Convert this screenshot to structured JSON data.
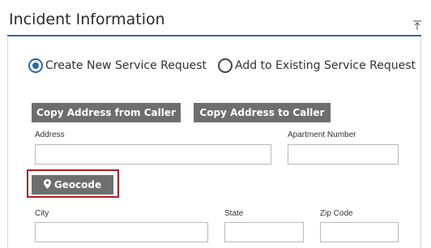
{
  "header": {
    "title": "Incident Information",
    "collapse_icon": "collapse-up-icon"
  },
  "request_type": {
    "options": [
      {
        "label": "Create New Service Request",
        "checked": true
      },
      {
        "label": "Add to Existing Service Request",
        "checked": false
      }
    ]
  },
  "buttons": {
    "copy_from_caller": "Copy Address from Caller",
    "copy_to_caller": "Copy Address to Caller",
    "geocode": "Geocode",
    "geocode_icon": "map-pin-icon"
  },
  "fields": {
    "address": {
      "label": "Address",
      "value": ""
    },
    "apartment": {
      "label": "Apartment Number",
      "value": ""
    },
    "city": {
      "label": "City",
      "value": ""
    },
    "state": {
      "label": "State",
      "value": ""
    },
    "zip": {
      "label": "Zip Code",
      "value": ""
    }
  },
  "colors": {
    "accent": "#2e68a6",
    "button": "#6e6e6e",
    "highlight": "#b01e23"
  }
}
